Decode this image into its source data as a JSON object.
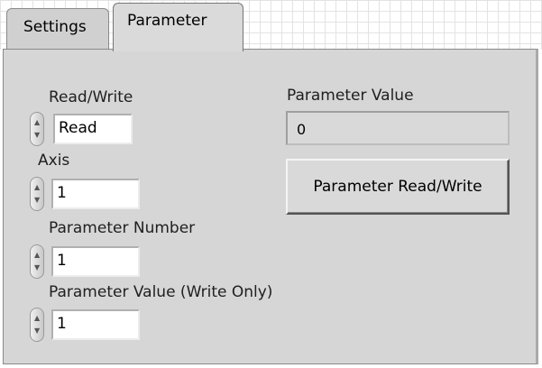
{
  "tabs": [
    {
      "label": "Settings"
    },
    {
      "label": "Parameter"
    }
  ],
  "controls": {
    "read_write": {
      "label": "Read/Write",
      "value": "Read"
    },
    "axis": {
      "label": "Axis",
      "value": "1"
    },
    "parameter_number": {
      "label": "Parameter Number",
      "value": "1"
    },
    "parameter_value_write": {
      "label": "Parameter Value (Write Only)",
      "value": "1"
    }
  },
  "indicator": {
    "label": "Parameter Value",
    "value": "0"
  },
  "button": {
    "label": "Parameter Read/Write"
  }
}
